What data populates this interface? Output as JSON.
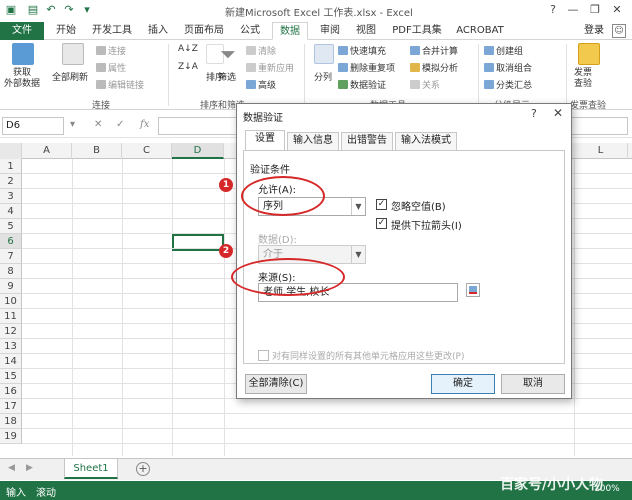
{
  "window": {
    "title": "新建Microsoft Excel 工作表.xlsx - Excel",
    "help": "?",
    "minimize": "—",
    "restore": "❐",
    "close": "✕"
  },
  "tabs": {
    "file": "文件",
    "items": [
      "开始",
      "开发工具",
      "插入",
      "页面布局",
      "公式",
      "数据",
      "审阅",
      "视图",
      "PDF工具集",
      "ACROBAT"
    ],
    "active": "数据",
    "login": "登录"
  },
  "ribbon": {
    "get_external": "获取\n外部数据",
    "refresh_all": "全部刷新",
    "connections": "连接",
    "properties": "属性",
    "edit_links": "编辑链接",
    "group_connections": "连接",
    "sort": "排序",
    "filter": "筛选",
    "clear": "清除",
    "reapply": "重新应用",
    "advanced": "高级",
    "group_sort": "排序和筛选",
    "split": "分列",
    "flash_fill": "快速填充",
    "remove_dup": "删除重复项",
    "data_validation": "数据验证",
    "consolidate": "合并计算",
    "what_if": "模拟分析",
    "relations": "关系",
    "group_tools": "数据工具",
    "group": "创建组",
    "ungroup": "取消组合",
    "subtotal": "分类汇总",
    "group_outline": "分级显示",
    "send_check": "发票\n查验",
    "group_invoice": "发票查验"
  },
  "formula_bar": {
    "name_box": "D6",
    "cancel": "✕",
    "enter": "✓",
    "fx": "fx",
    "value": ""
  },
  "grid": {
    "columns": [
      "A",
      "B",
      "C",
      "D",
      "L"
    ],
    "rows": [
      "1",
      "2",
      "3",
      "4",
      "5",
      "6",
      "7",
      "8",
      "9",
      "10",
      "11",
      "12",
      "13",
      "14",
      "15",
      "16",
      "17",
      "18",
      "19"
    ],
    "selected_cell": "D6"
  },
  "sheets": {
    "tab": "Sheet1",
    "add": "+"
  },
  "status": {
    "mode": "输入",
    "scroll": "滚动",
    "zoom": "100%"
  },
  "dialog": {
    "title": "数据验证",
    "help": "?",
    "close": "✕",
    "tabs": [
      "设置",
      "输入信息",
      "出错警告",
      "输入法模式"
    ],
    "active_tab": "设置",
    "section": "验证条件",
    "allow_label": "允许(A):",
    "allow_value": "序列",
    "ignore_blank": "忽略空值(B)",
    "ignore_blank_checked": true,
    "dropdown_arrow": "提供下拉箭头(I)",
    "dropdown_arrow_checked": true,
    "data_label": "数据(D):",
    "data_value": "介于",
    "source_label": "来源(S):",
    "source_value": "老师,学生,校长",
    "apply_all": "对有同样设置的所有其他单元格应用这些更改(P)",
    "clear_all": "全部清除(C)",
    "ok": "确定",
    "cancel": "取消",
    "annotation_1": "1",
    "annotation_2": "2"
  },
  "colors": {
    "excel_green": "#217346",
    "annotation_red": "#d62828"
  },
  "watermark": "百家号/小小人物"
}
